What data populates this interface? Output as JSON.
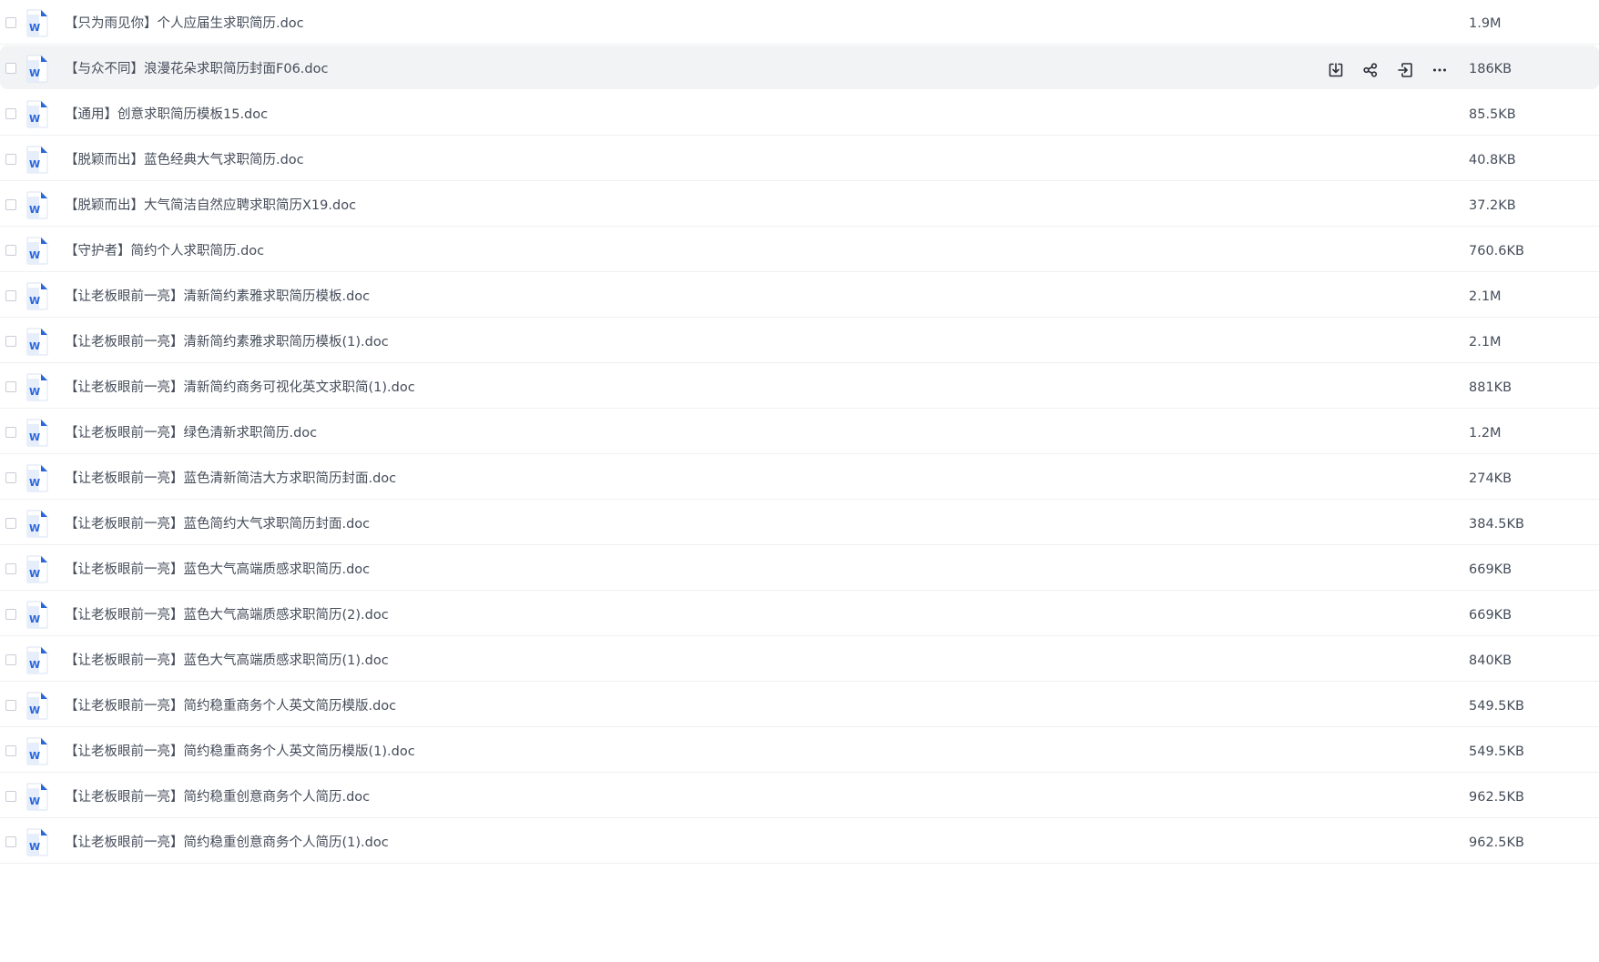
{
  "files": [
    {
      "name": "【只为雨见你】个人应届生求职简历.doc",
      "size": "1.9M"
    },
    {
      "name": "【与众不同】浪漫花朵求职简历封面F06.doc",
      "size": "186KB"
    },
    {
      "name": "【通用】创意求职简历模板15.doc",
      "size": "85.5KB"
    },
    {
      "name": "【脱颖而出】蓝色经典大气求职简历.doc",
      "size": "40.8KB"
    },
    {
      "name": "【脱颖而出】大气简洁自然应聘求职简历X19.doc",
      "size": "37.2KB"
    },
    {
      "name": "【守护者】简约个人求职简历.doc",
      "size": "760.6KB"
    },
    {
      "name": "【让老板眼前一亮】清新简约素雅求职简历模板.doc",
      "size": "2.1M"
    },
    {
      "name": "【让老板眼前一亮】清新简约素雅求职简历模板(1).doc",
      "size": "2.1M"
    },
    {
      "name": "【让老板眼前一亮】清新简约商务可视化英文求职简(1).doc",
      "size": "881KB"
    },
    {
      "name": "【让老板眼前一亮】绿色清新求职简历.doc",
      "size": "1.2M"
    },
    {
      "name": "【让老板眼前一亮】蓝色清新简洁大方求职简历封面.doc",
      "size": "274KB"
    },
    {
      "name": "【让老板眼前一亮】蓝色简约大气求职简历封面.doc",
      "size": "384.5KB"
    },
    {
      "name": "【让老板眼前一亮】蓝色大气高端质感求职简历.doc",
      "size": "669KB"
    },
    {
      "name": "【让老板眼前一亮】蓝色大气高端质感求职简历(2).doc",
      "size": "669KB"
    },
    {
      "name": "【让老板眼前一亮】蓝色大气高端质感求职简历(1).doc",
      "size": "840KB"
    },
    {
      "name": "【让老板眼前一亮】简约稳重商务个人英文简历模版.doc",
      "size": "549.5KB"
    },
    {
      "name": "【让老板眼前一亮】简约稳重商务个人英文简历模版(1).doc",
      "size": "549.5KB"
    },
    {
      "name": "【让老板眼前一亮】简约稳重创意商务个人简历.doc",
      "size": "962.5KB"
    },
    {
      "name": "【让老板眼前一亮】简约稳重创意商务个人简历(1).doc",
      "size": "962.5KB"
    }
  ],
  "hovered_row": 1,
  "row_actions": [
    "download-icon",
    "share-icon",
    "move-icon",
    "more-icon"
  ],
  "file_icon": "word-doc-icon",
  "colors": {
    "text": "#454d5a",
    "hover_bg": "#f2f3f5",
    "divider": "#eef0f3",
    "word_blue": "#2b66d9"
  }
}
